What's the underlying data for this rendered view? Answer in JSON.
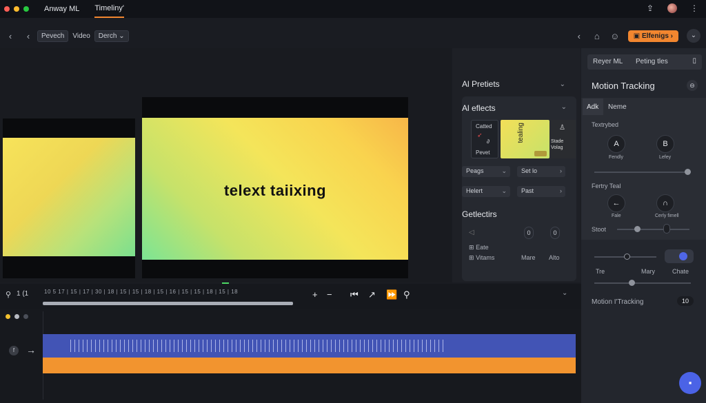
{
  "titlebar": {
    "app_name": "Anway ML",
    "active_tab": "Timeliny'",
    "window_dots": [
      "#ff5f57",
      "#febc2e",
      "#28c840"
    ]
  },
  "toolbar": {
    "left_pill_1": "Pevech",
    "left_plain": "Video",
    "left_pill_2": "Derch",
    "right_button": "Elfenigs"
  },
  "preview": {
    "main_text": "telext taiixing"
  },
  "ai_panel": {
    "section1_title": "Al Pretiets",
    "section2_title": "Al eflects",
    "thumb_a_line1": "Catted",
    "thumb_a_line2": "Pevet",
    "thumb_c_line1": "Stade",
    "thumb_c_line2": "Volag",
    "drop1": "Peags",
    "drop2": "Set lo",
    "drop3": "Helert",
    "drop4": "Past",
    "section3_title": "Getlectirs",
    "knob1": "0",
    "knob2": "0",
    "list_item1": "Eate",
    "list_item2": "Vitams",
    "col_label1": "Mare",
    "col_label2": "Alto"
  },
  "right_panel": {
    "top_item1": "Reyer ML",
    "top_item2": "Peting tles",
    "title": "Motion Tracking",
    "tab1": "Adk",
    "tab2": "Neme",
    "section_label1": "Textrybed",
    "btn_a": "A",
    "btn_b": "B",
    "btn_a_label": "Fendly",
    "btn_b_label": "Lefey",
    "section_label2": "Fertry Teal",
    "btn_c_label": "Fale",
    "btn_d_label": "Cerly fimell",
    "slider_label": "Stoot",
    "lower_label1": "Tre",
    "lower_label2": "Mary",
    "lower_label3": "Chate",
    "footer_label": "Motion I'Tracking",
    "footer_value": "10"
  },
  "timeline": {
    "ruler": "10   5   17  | 15 | 17  | 30  | 18   | 15   | 15  | 18   | 15   | 16   | 15   | 15  | 18   | 15   | 18",
    "left_label": "1 (1",
    "track_colors": {
      "video": "#4254b5",
      "audio": "#f2942f"
    }
  }
}
